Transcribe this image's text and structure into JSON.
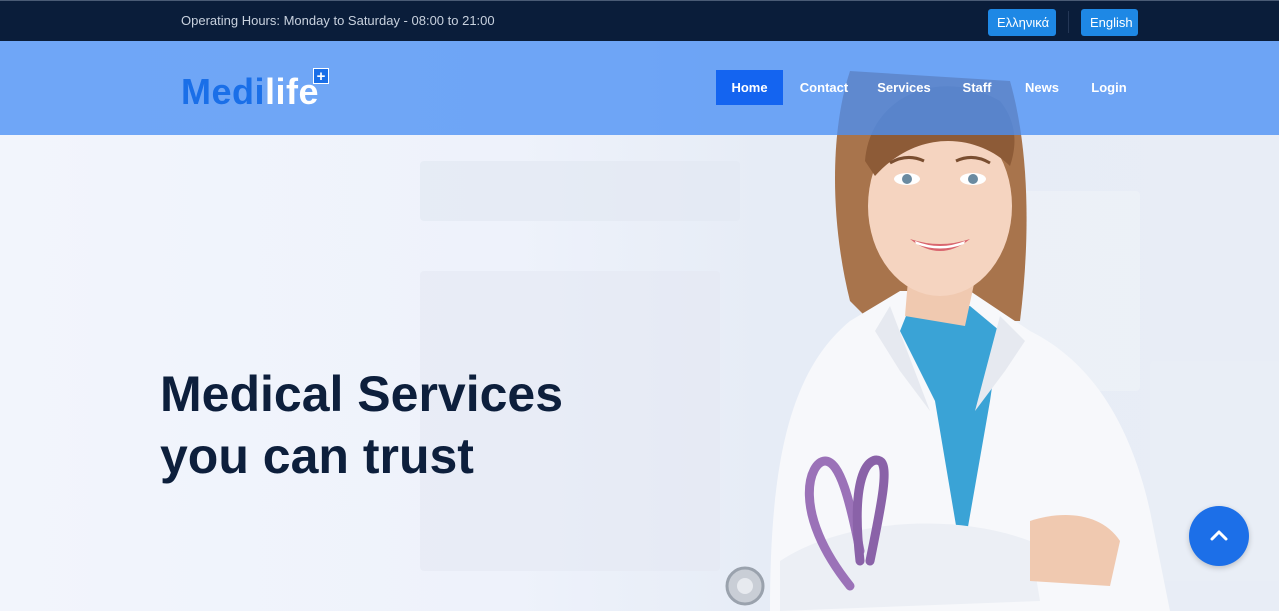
{
  "topbar": {
    "hours": "Operating Hours: Monday to Saturday - 08:00 to 21:00",
    "lang_el": "Ελληνικά",
    "lang_en": "English"
  },
  "logo": {
    "part1": "Medi",
    "part2": "life",
    "plus": "+"
  },
  "nav": {
    "home": "Home",
    "contact": "Contact",
    "services": "Services",
    "staff": "Staff",
    "news": "News",
    "login": "Login"
  },
  "hero": {
    "line1": "Medical Services",
    "line2": "you can trust"
  },
  "icons": {
    "back_to_top": "chevron-up-icon"
  },
  "colors": {
    "topbar": "#0a1d3a",
    "accent": "#1464f0",
    "nav_bg": "#4a90f5",
    "headline": "#0d1f3c"
  }
}
